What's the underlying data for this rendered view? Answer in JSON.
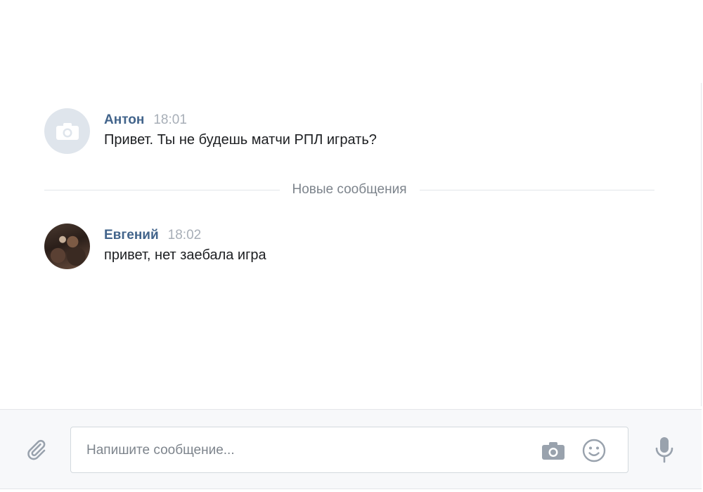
{
  "messages": [
    {
      "author": "Антон",
      "time": "18:01",
      "text": "Привет. Ты не будешь матчи РПЛ играть?",
      "avatar": "camera-placeholder"
    },
    {
      "author": "Евгений",
      "time": "18:02",
      "text": "привет, нет заебала игра",
      "avatar": "user-photo"
    }
  ],
  "divider": {
    "label": "Новые сообщения"
  },
  "composer": {
    "placeholder": "Напишите сообщение...",
    "icons": [
      "paperclip-icon",
      "camera-icon",
      "smile-icon",
      "microphone-icon"
    ]
  },
  "colors": {
    "author": "#42648b",
    "time": "#a7aeb7",
    "icon": "#99a2ad",
    "composer_bg": "#f7f8fa"
  }
}
